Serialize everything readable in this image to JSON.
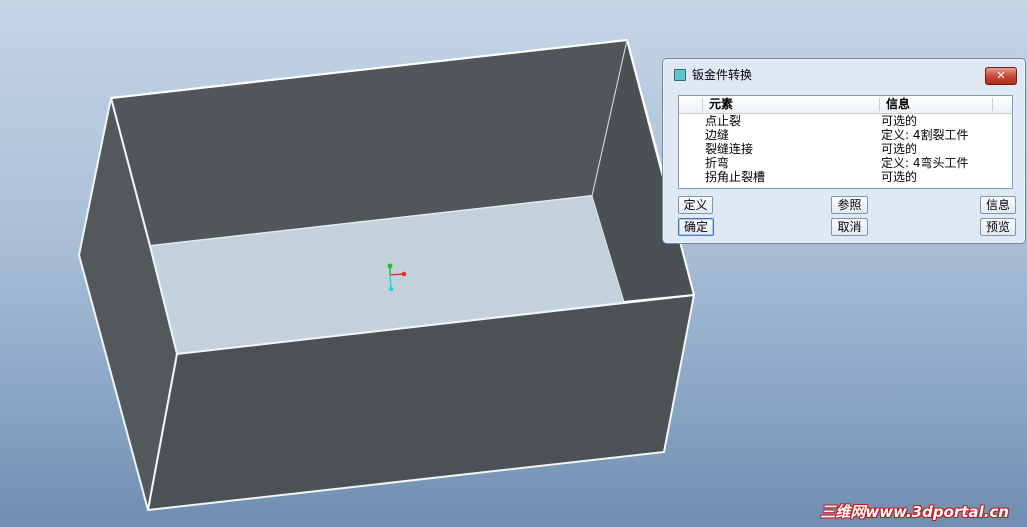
{
  "dialog": {
    "title": "钣金件转换",
    "close_label": "✕",
    "columns": [
      "元素",
      "信息"
    ],
    "rows": [
      {
        "element": "点止裂",
        "info": "可选的"
      },
      {
        "element": "边缝",
        "info": "定义: 4割裂工件"
      },
      {
        "element": "裂缝连接",
        "info": "可选的"
      },
      {
        "element": "折弯",
        "info": "定义: 4弯头工件"
      },
      {
        "element": "拐角止裂槽",
        "info": "可选的"
      }
    ],
    "buttons": {
      "define": "定义",
      "reference": "参照",
      "info": "信息",
      "ok": "确定",
      "cancel": "取消",
      "preview": "预览"
    }
  },
  "watermark": "三维网www.3dportal.cn",
  "colors": {
    "model_dark": "#4f5458",
    "model_floor": "#c2d1dc",
    "axis_x": "#e53030",
    "axis_y": "#22c030",
    "axis_z": "#28d0e0"
  }
}
